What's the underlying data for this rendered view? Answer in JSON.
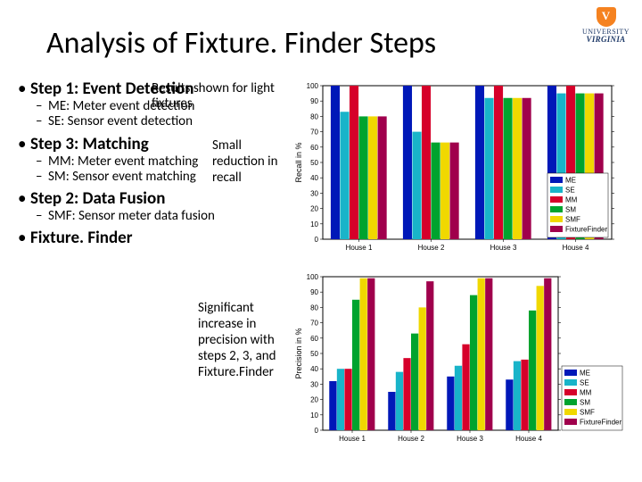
{
  "logo": {
    "line1": "UNIVERSITY",
    "line2": "VIRGINIA"
  },
  "title": "Analysis of Fixture. Finder Steps",
  "notes": {
    "results": "Results shown for light fixtures",
    "recall": "Small reduction in recall",
    "precision": "Significant increase in precision with steps 2, 3, and Fixture.Finder"
  },
  "bullets": {
    "step1": {
      "title": "Step 1: Event Detection",
      "me": "ME: Meter event detection",
      "se": "SE: Sensor event detection"
    },
    "step3": {
      "title": "Step 3: Matching",
      "mm": "MM: Meter event matching",
      "sm": "SM: Sensor event matching"
    },
    "step2": {
      "title": "Step 2: Data Fusion",
      "smf": "SMF: Sensor meter data fusion"
    },
    "ff": {
      "title": "Fixture. Finder"
    }
  },
  "chart_data": [
    {
      "type": "bar",
      "ylabel": "Recall in %",
      "ylim": [
        0,
        100
      ],
      "yticks": [
        0,
        10,
        20,
        30,
        40,
        50,
        60,
        70,
        80,
        90,
        100
      ],
      "categories": [
        "House 1",
        "House 2",
        "House 3",
        "House 4"
      ],
      "series": [
        {
          "name": "ME",
          "color": "#0018b8",
          "values": [
            100,
            100,
            100,
            100
          ]
        },
        {
          "name": "SE",
          "color": "#19b4c9",
          "values": [
            83,
            70,
            92,
            95
          ]
        },
        {
          "name": "MM",
          "color": "#d6002a",
          "values": [
            100,
            100,
            100,
            100
          ]
        },
        {
          "name": "SM",
          "color": "#00a32e",
          "values": [
            80,
            63,
            92,
            95
          ]
        },
        {
          "name": "SMF",
          "color": "#f0d800",
          "values": [
            80,
            63,
            92,
            95
          ]
        },
        {
          "name": "FixtureFinder",
          "color": "#a0004c",
          "values": [
            80,
            63,
            92,
            95
          ]
        }
      ],
      "legend_pos": "inside-right"
    },
    {
      "type": "bar",
      "ylabel": "Precision in %",
      "ylim": [
        0,
        100
      ],
      "yticks": [
        0,
        10,
        20,
        30,
        40,
        50,
        60,
        70,
        80,
        90,
        100
      ],
      "categories": [
        "House 1",
        "House 2",
        "House 3",
        "House 4"
      ],
      "series": [
        {
          "name": "ME",
          "color": "#0018b8",
          "values": [
            32,
            25,
            35,
            33
          ]
        },
        {
          "name": "SE",
          "color": "#19b4c9",
          "values": [
            40,
            38,
            42,
            45
          ]
        },
        {
          "name": "MM",
          "color": "#d6002a",
          "values": [
            40,
            47,
            56,
            46
          ]
        },
        {
          "name": "SM",
          "color": "#00a32e",
          "values": [
            85,
            63,
            88,
            78
          ]
        },
        {
          "name": "SMF",
          "color": "#f0d800",
          "values": [
            99,
            80,
            99,
            94
          ]
        },
        {
          "name": "FixtureFinder",
          "color": "#a0004c",
          "values": [
            99,
            97,
            99,
            99
          ]
        }
      ],
      "legend_pos": "outside-right"
    }
  ]
}
